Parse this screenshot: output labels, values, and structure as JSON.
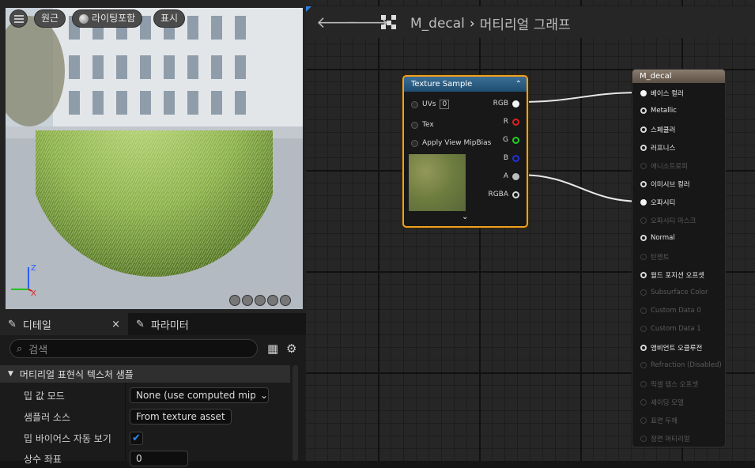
{
  "viewport": {
    "buttons": {
      "menu_icon": "hamburger-icon",
      "perspective": "원근",
      "lighting": "라이팅포함",
      "show": "표시"
    },
    "axes": {
      "z": "Z",
      "x": "X"
    }
  },
  "details": {
    "tabs": [
      {
        "label": "디테일",
        "close": "×"
      },
      {
        "label": "파라미터"
      }
    ],
    "search_placeholder": "검색",
    "section_title": "머티리얼 표현식 텍스처 샘플",
    "rows": [
      {
        "label": "밉 값 모드",
        "value": "None (use computed mip lev"
      },
      {
        "label": "샘플러 소스",
        "value": "From texture asset"
      },
      {
        "label": "밉 바이어스 자동 보기",
        "checked": true
      },
      {
        "label": "상수 좌표",
        "value": "0"
      }
    ]
  },
  "graph": {
    "breadcrumb": {
      "material": "M_decal",
      "separator": "›",
      "view": "머티리얼 그래프"
    },
    "texture_node": {
      "title": "Texture Sample",
      "inputs": [
        {
          "label": "UVs",
          "value": "0"
        },
        {
          "label": "Tex"
        },
        {
          "label": "Apply View MipBias"
        }
      ],
      "outputs": [
        "RGB",
        "R",
        "G",
        "B",
        "A",
        "RGBA"
      ]
    },
    "material_node": {
      "title": "M_decal",
      "pins": [
        {
          "label": "베이스 컬러",
          "active": true,
          "connected": true
        },
        {
          "label": "Metallic",
          "active": true
        },
        {
          "label": "스페큘러",
          "active": true
        },
        {
          "label": "러프니스",
          "active": true
        },
        {
          "label": "애니소트로피",
          "active": false
        },
        {
          "label": "이미시브 컬러",
          "active": true
        },
        {
          "label": "오파시티",
          "active": true,
          "connected": true
        },
        {
          "label": "오파시티 마스크",
          "active": false
        },
        {
          "label": "Normal",
          "active": true
        },
        {
          "label": "탄젠트",
          "active": false
        },
        {
          "label": "월드 포지션 오프셋",
          "active": true
        },
        {
          "label": "Subsurface Color",
          "active": false
        },
        {
          "label": "Custom Data 0",
          "active": false
        },
        {
          "label": "Custom Data 1",
          "active": false
        },
        {
          "label": "앰비언트 오클루전",
          "active": true
        },
        {
          "label": "Refraction (Disabled)",
          "active": false
        },
        {
          "label": "픽셀 뎁스 오프셋",
          "active": false
        },
        {
          "label": "셰이딩 모델",
          "active": false
        },
        {
          "label": "표면 두께",
          "active": false
        },
        {
          "label": "정면 머티리얼",
          "active": false
        }
      ]
    }
  }
}
